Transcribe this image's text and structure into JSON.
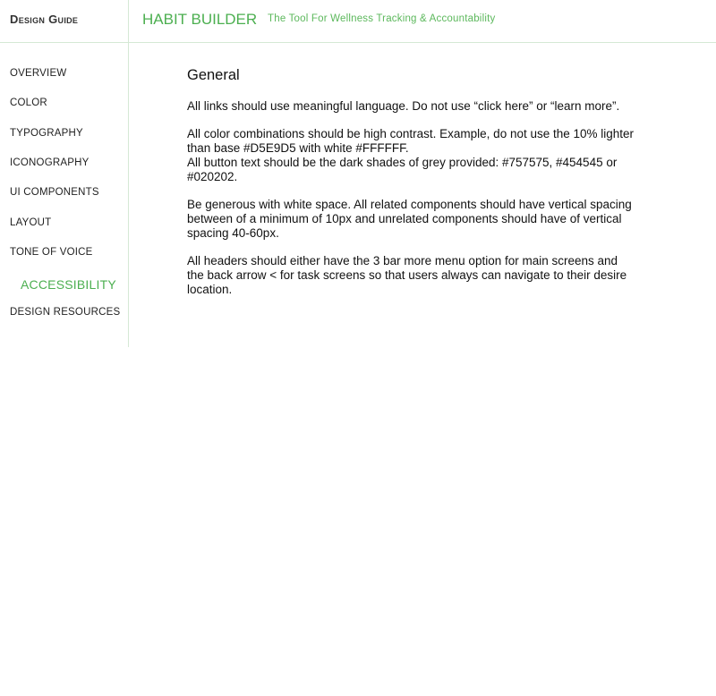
{
  "header": {
    "brand": "Design Guide",
    "app_title": "HABIT BUILDER",
    "tagline": "The Tool For Wellness Tracking & Accountability"
  },
  "sidebar": {
    "items": [
      {
        "label": "OVERVIEW"
      },
      {
        "label": "COLOR"
      },
      {
        "label": "TYPOGRAPHY"
      },
      {
        "label": "ICONOGRAPHY"
      },
      {
        "label": "UI COMPONENTS"
      },
      {
        "label": "LAYOUT"
      },
      {
        "label": "TONE OF VOICE"
      },
      {
        "label": "ACCESSIBILITY",
        "active": true
      },
      {
        "label": "DESIGN RESOURCES"
      }
    ]
  },
  "main": {
    "heading": "General",
    "paragraphs": [
      "All links should use meaningful language. Do not use “click here” or “learn more”.",
      "All color combinations should be high contrast. Example, do not use the 10% lighter than base #D5E9D5 with white #FFFFFF.",
      "All button text should be the dark shades of grey provided: #757575, #454545 or #020202.",
      "Be generous with white space. All related components should have vertical spacing between of a minimum of 10px and unrelated components should have of vertical spacing 40-60px.",
      "All headers should either have the 3 bar more menu option for main screens and the back arrow < for task screens so that users always can navigate to their desire location."
    ]
  },
  "colors": {
    "accent": "#4CAF50",
    "divider": "#D5E9D5",
    "text": "#111111"
  }
}
